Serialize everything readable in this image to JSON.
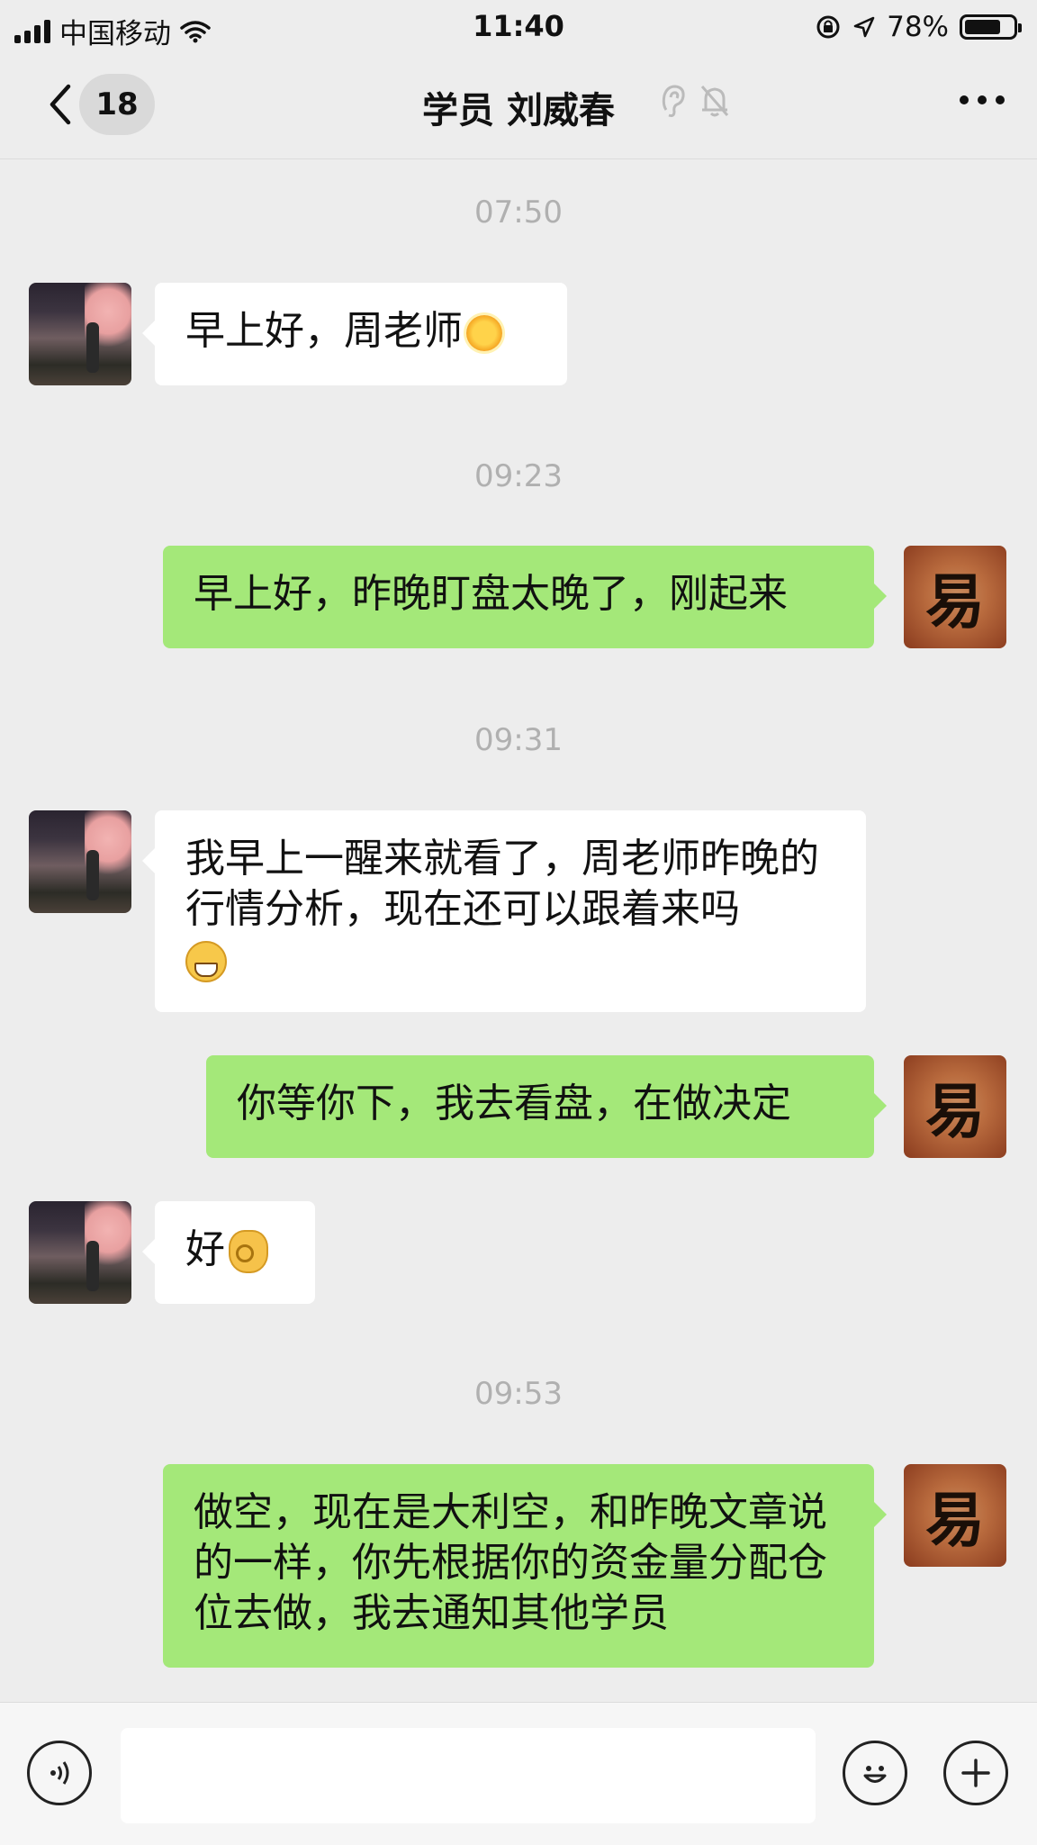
{
  "status_bar": {
    "carrier": "中国移动",
    "time": "11:40",
    "battery_percent": "78%",
    "battery_level": 0.78,
    "icons": [
      "signal-icon",
      "wifi-icon",
      "orientation-lock-icon",
      "location-icon",
      "battery-icon"
    ]
  },
  "header": {
    "back_icon": "chevron-left-icon",
    "unread_count": "18",
    "title": "学员 刘威春",
    "title_icons": [
      "ear-icon",
      "mute-bell-icon"
    ],
    "more_icon": "more-icon"
  },
  "messages": [
    {
      "kind": "timestamp",
      "text": "07:50"
    },
    {
      "kind": "incoming",
      "text": "早上好，周老师",
      "emoji": "sun-emoji"
    },
    {
      "kind": "timestamp",
      "text": "09:23"
    },
    {
      "kind": "outgoing",
      "text": "早上好，昨晚盯盘太晚了，刚起来"
    },
    {
      "kind": "timestamp",
      "text": "09:31"
    },
    {
      "kind": "incoming",
      "text": "我早上一醒来就看了，周老师昨晚的行情分析，现在还可以跟着来吗",
      "emoji": "grin-emoji"
    },
    {
      "kind": "outgoing",
      "text": "你等你下，我去看盘，在做决定"
    },
    {
      "kind": "incoming",
      "text": "好",
      "emoji": "ok-hand-emoji"
    },
    {
      "kind": "timestamp",
      "text": "09:53"
    },
    {
      "kind": "outgoing",
      "text": "做空，现在是大利空，和昨晚文章说的一样，你先根据你的资金量分配仓位去做，我去通知其他学员"
    }
  ],
  "input_bar": {
    "voice_icon": "voice-icon",
    "text_value": "",
    "emoji_icon": "emoji-icon",
    "add_icon": "add-icon"
  },
  "colors": {
    "background": "#ededed",
    "outgoing_bubble": "#a4e879",
    "incoming_bubble": "#ffffff",
    "timestamp_text": "#b0b0b0"
  }
}
